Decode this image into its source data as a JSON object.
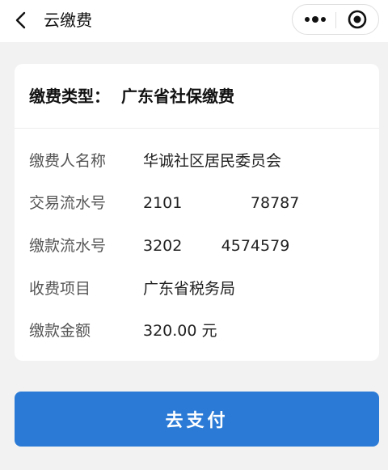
{
  "nav": {
    "title": "云缴费"
  },
  "card": {
    "type_label": "缴费类型：",
    "type_value": "广东省社保缴费",
    "rows": [
      {
        "label": "缴费人名称",
        "value": "华诚社区居民委员会"
      },
      {
        "label": "交易流水号",
        "value": "2101              78787"
      },
      {
        "label": "缴款流水号",
        "value": "3202        4574579"
      },
      {
        "label": "收费项目",
        "value": "广东省税务局"
      },
      {
        "label": "缴款金额",
        "value": "320.00 元"
      }
    ]
  },
  "actions": {
    "pay_label": "去支付"
  }
}
